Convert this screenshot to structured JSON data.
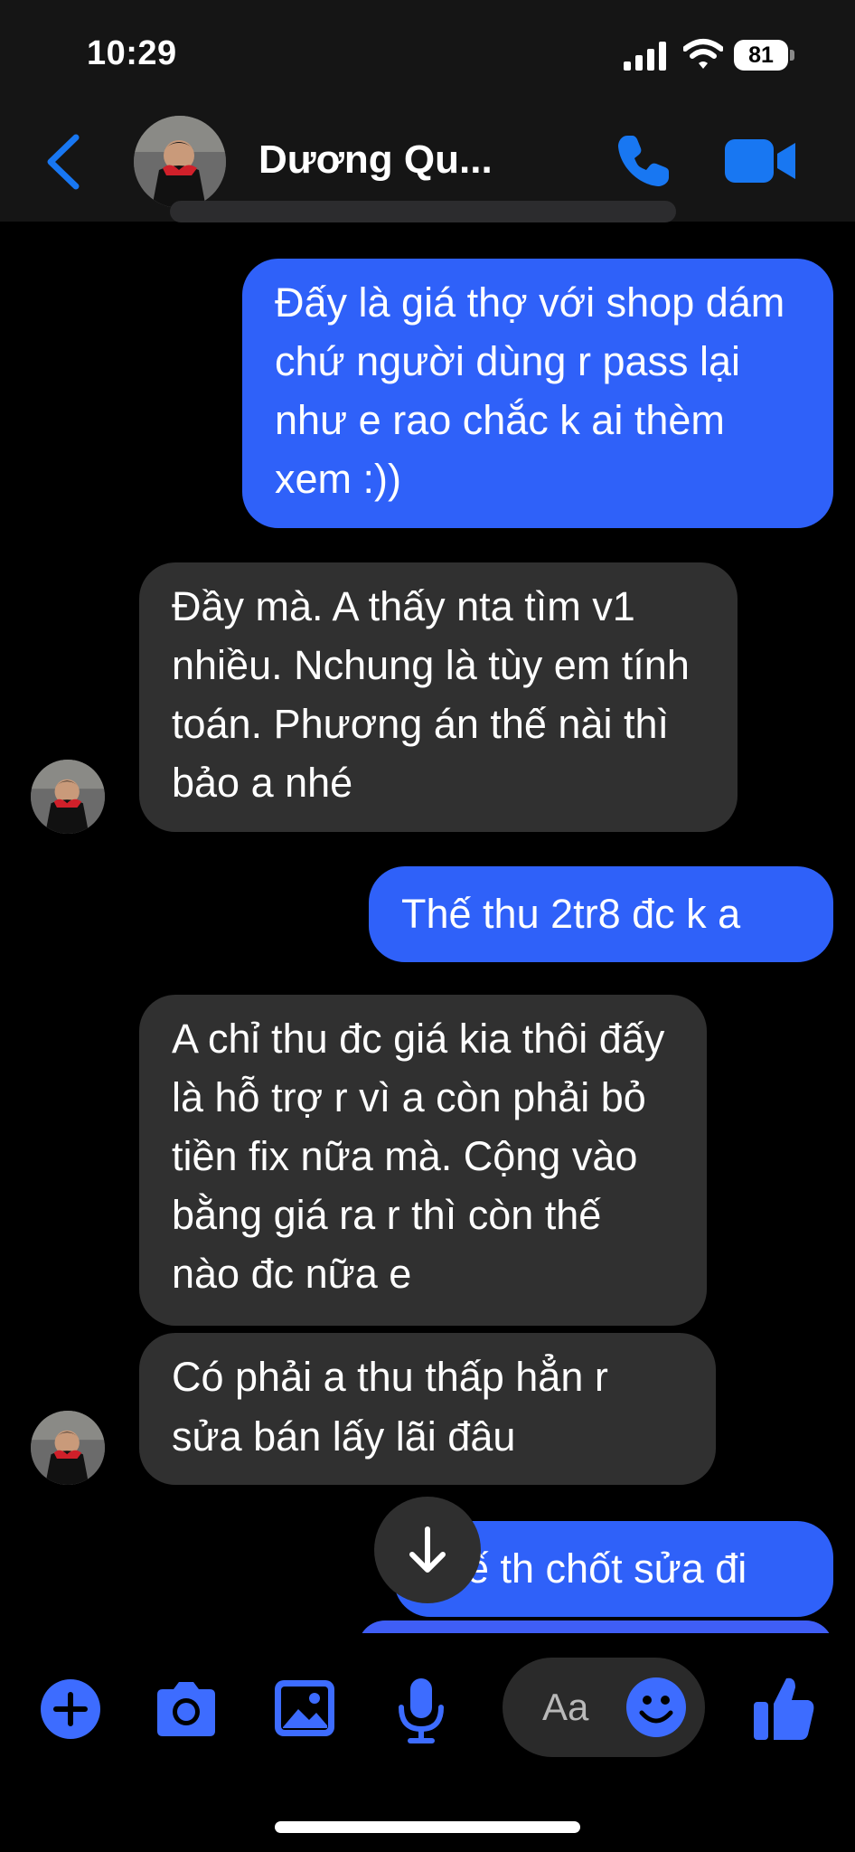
{
  "status_bar": {
    "time": "10:29",
    "battery": "81"
  },
  "header": {
    "contact_name": "Dương Qu..."
  },
  "messages": [
    {
      "side": "out",
      "text": "Đấy là giá thợ với shop dám chứ người dùng r pass lại như e rao chắc k ai thèm xem :))"
    },
    {
      "side": "in",
      "text": "Đầy mà. A thấy nta tìm v1 nhiều. Nchung là tùy em tính toán. Phương án thế nài thì bảo a nhé"
    },
    {
      "side": "out",
      "text": "Thế thu 2tr8 đc k a"
    },
    {
      "side": "in",
      "text": "A chỉ thu đc giá kia thôi đấy là hỗ trợ r vì a còn phải bỏ tiền fix nữa mà. Cộng vào bằng giá ra r thì còn thế nào đc nữa e"
    },
    {
      "side": "in",
      "text": "Có phải a thu thấp hẳn r sửa bán lấy lãi đâu"
    },
    {
      "side": "out",
      "text": "ế th chốt sửa đi"
    }
  ],
  "composer": {
    "placeholder": "Aa"
  },
  "colors": {
    "accent": "#2f61f9",
    "incoming_bubble": "#303030",
    "icon_blue": "#3d6cff",
    "header_icon_blue": "#1877f2"
  },
  "icons": [
    "back-icon",
    "phone-icon",
    "video-camera-icon",
    "plus-icon",
    "camera-icon",
    "image-icon",
    "microphone-icon",
    "emoji-icon",
    "thumbs-up-icon",
    "arrow-down-icon"
  ]
}
